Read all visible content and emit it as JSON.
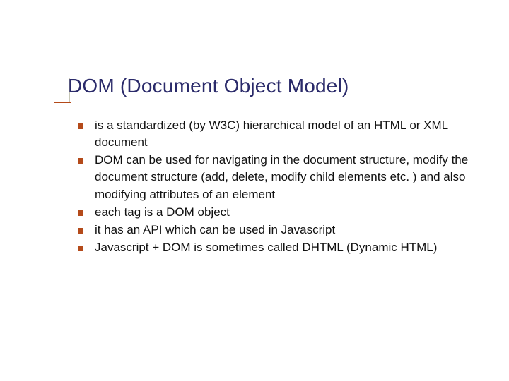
{
  "slide": {
    "title": "DOM (Document Object Model)",
    "bullets": [
      "is a standardized (by W3C) hierarchical model of an HTML or XML document",
      "DOM can be used for navigating in the document structure, modify the document structure (add, delete, modify child elements etc. ) and also modifying attributes of an element",
      "each tag is a DOM object",
      "it has an API which can be used in Javascript",
      "Javascript + DOM is sometimes called DHTML (Dynamic HTML)"
    ]
  }
}
